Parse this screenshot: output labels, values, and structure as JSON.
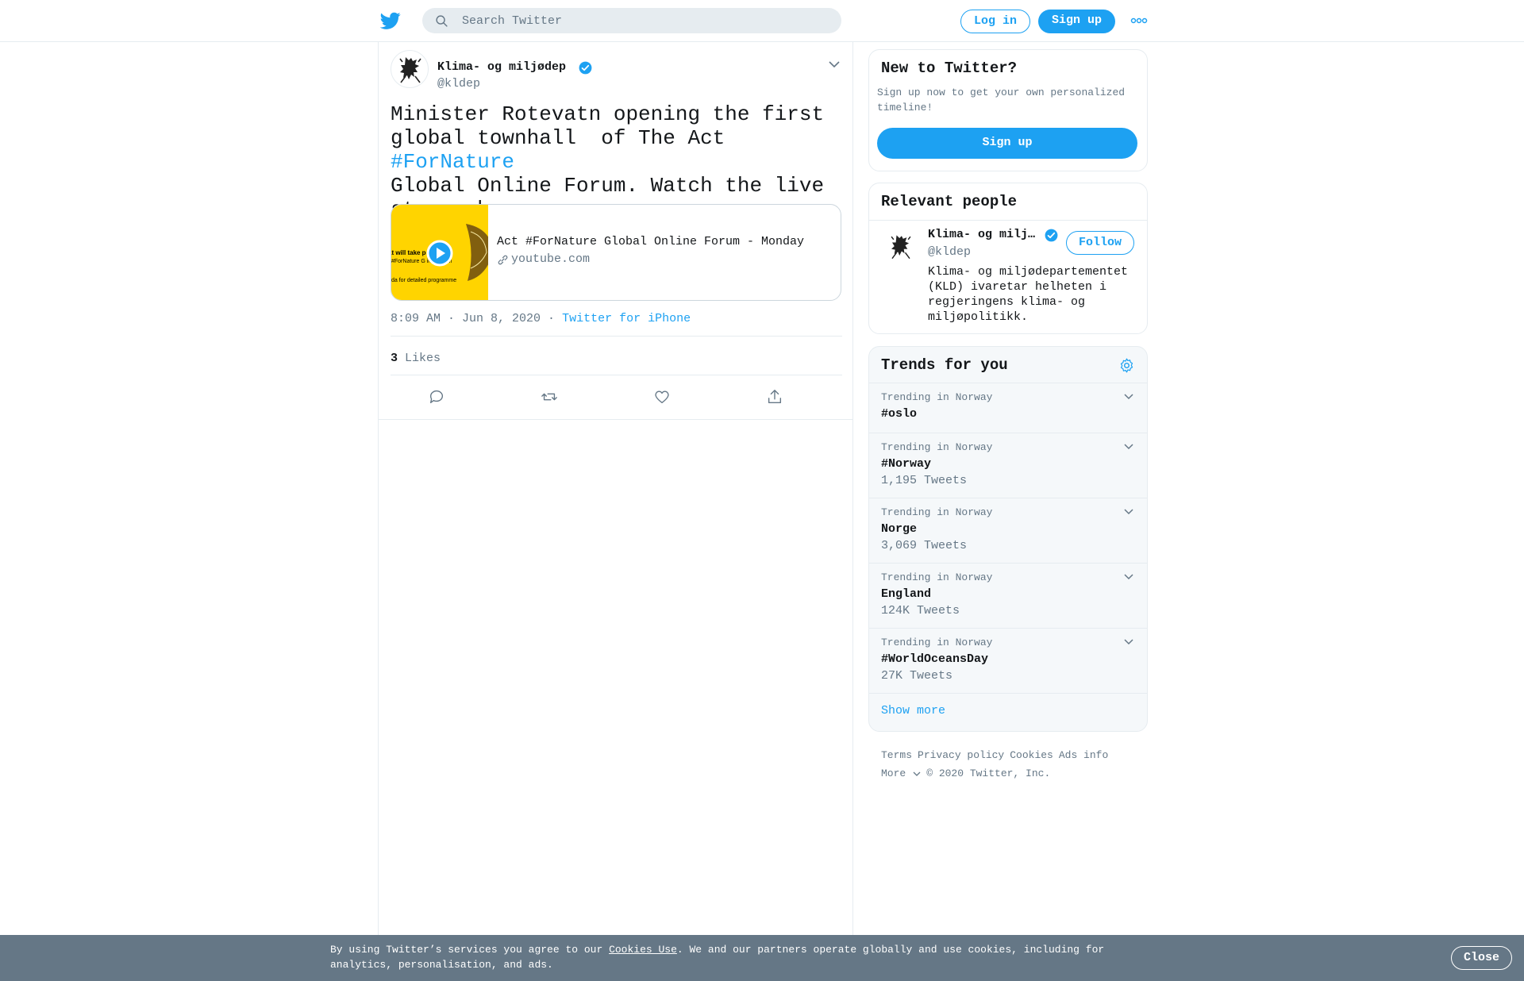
{
  "header": {
    "search_placeholder": "Search Twitter",
    "login_label": "Log in",
    "signup_label": "Sign up"
  },
  "tweet": {
    "author_name": "Klima- og miljødep",
    "author_handle": "@kldep",
    "text_part1": "Minister Rotevatn opening the first\nglobal townhall  of The Act ",
    "hashtag": "#ForNature",
    "text_part2": "\nGlobal Online Forum. Watch the live\nstream here:",
    "card": {
      "title": "Act #ForNature Global Online Forum - Monday",
      "domain": "youtube.com",
      "thumb_line1": "at will take p     th June",
      "thumb_line2": "#ForNature G     ine Forum",
      "thumb_line3": "da for detailed programme"
    },
    "time": "8:09 AM · Jun 8, 2020",
    "separator": "·",
    "source": "Twitter for iPhone",
    "likes_count": "3",
    "likes_label": "Likes"
  },
  "sidebar": {
    "new_title": "New to Twitter?",
    "new_desc": "Sign up now to get your own personalized timeline!",
    "new_signup": "Sign up",
    "people_title": "Relevant people",
    "person": {
      "name": "Klima- og milj…",
      "handle": "@kldep",
      "follow": "Follow",
      "bio": "Klima- og miljødepartementet (KLD) ivaretar helheten i regjeringens klima- og miljøpolitikk."
    },
    "trends_title": "Trends for you",
    "trends": [
      {
        "context": "Trending in Norway",
        "name": "#oslo",
        "count": ""
      },
      {
        "context": "Trending in Norway",
        "name": "#Norway",
        "count": "1,195 Tweets"
      },
      {
        "context": "Trending in Norway",
        "name": "Norge",
        "count": "3,069 Tweets"
      },
      {
        "context": "Trending in Norway",
        "name": "England",
        "count": "124K Tweets"
      },
      {
        "context": "Trending in Norway",
        "name": "#WorldOceansDay",
        "count": "27K Tweets"
      }
    ],
    "show_more": "Show more",
    "footer": {
      "terms": "Terms",
      "privacy": "Privacy policy",
      "cookies": "Cookies",
      "ads": "Ads info",
      "more": "More",
      "copyright": "© 2020 Twitter, Inc."
    }
  },
  "cookie_bar": {
    "text_before": "By using Twitter’s services you agree to our ",
    "link": "Cookies Use",
    "text_after": ". We and our partners operate globally and use cookies, including for analytics, personalisation, and ads.",
    "close": "Close"
  },
  "colors": {
    "accent": "#1da1f2",
    "text": "#14171a",
    "muted": "#657786",
    "border": "#e6ecf0",
    "cookie_bg": "#657786",
    "card_thumb": "#ffd400"
  }
}
